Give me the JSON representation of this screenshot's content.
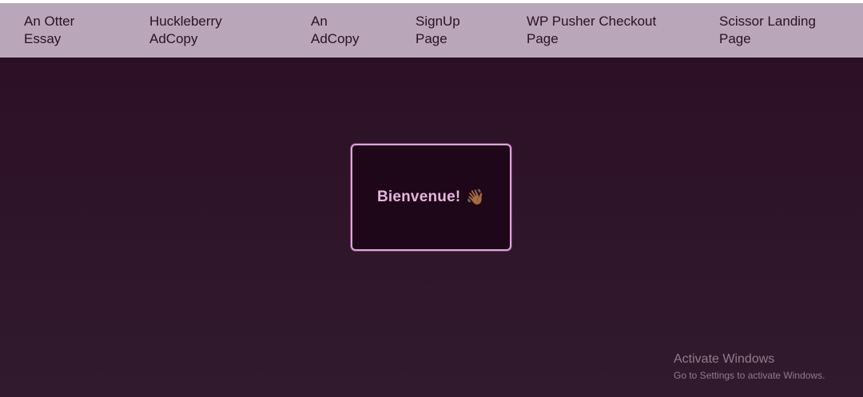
{
  "nav": {
    "items": [
      {
        "label": "An Otter Essay"
      },
      {
        "label": "Huckleberry AdCopy"
      },
      {
        "label": "An AdCopy"
      },
      {
        "label": "SignUp Page"
      },
      {
        "label": "WP Pusher Checkout Page"
      },
      {
        "label": "Scissor Landing Page"
      }
    ]
  },
  "card": {
    "text": "Bienvenue!",
    "icon": "👋🏾"
  },
  "watermark": {
    "title": "Activate Windows",
    "subtitle": "Go to Settings to activate Windows."
  },
  "colors": {
    "navbar_bg": "#baa6b9",
    "page_bg": "#2c0e24",
    "card_bg": "#1d0718",
    "card_border": "#e0a4dc",
    "card_text": "#e8b4df"
  }
}
